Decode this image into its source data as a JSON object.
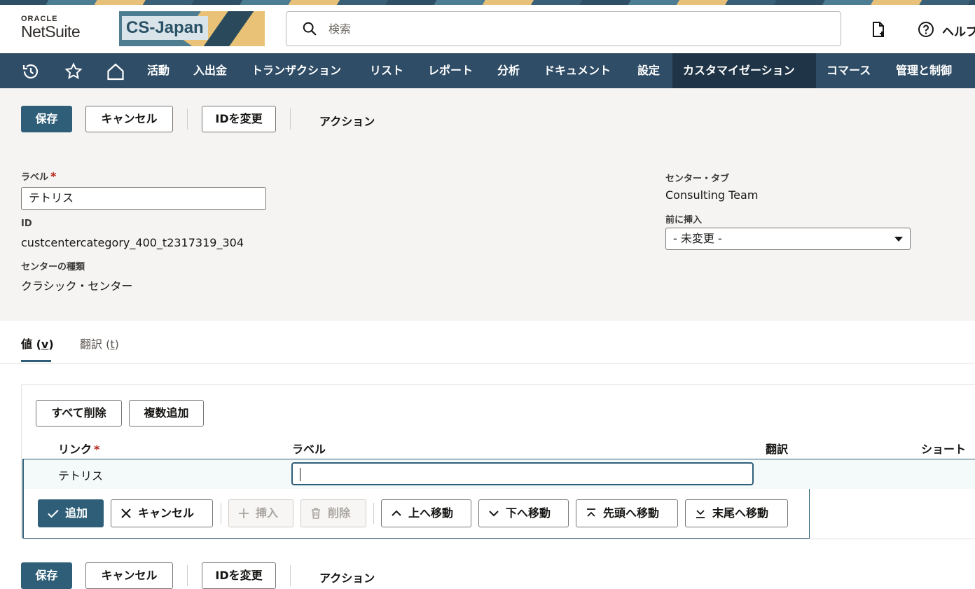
{
  "header": {
    "logo_top": "ORACLE",
    "logo_bottom": "NetSuite",
    "banner_text": "CS-Japan",
    "search_placeholder": "検索",
    "help_label": "ヘルプ"
  },
  "nav": {
    "items": [
      "活動",
      "入出金",
      "トランザクション",
      "リスト",
      "レポート",
      "分析",
      "ドキュメント",
      "設定",
      "カスタマイゼーション",
      "コマース",
      "管理と制御"
    ],
    "active_index": 8
  },
  "toolbar": {
    "save": "保存",
    "cancel": "キャンセル",
    "change_id": "IDを変更",
    "actions": "アクション"
  },
  "form": {
    "label_label": "ラベル",
    "required_mark": "*",
    "label_value": "テトリス",
    "id_label": "ID",
    "id_value": "custcentercategory_400_t2317319_304",
    "center_type_label": "センターの種類",
    "center_type_value": "クラシック・センター",
    "center_tab_label": "センター・タブ",
    "center_tab_value": "Consulting Team",
    "insert_before_label": "前に挿入",
    "insert_before_value": "- 未変更 -"
  },
  "tabs": [
    {
      "label": "値 (",
      "key": "v",
      "suffix": ")"
    },
    {
      "label": "翻訳 (",
      "key": "t",
      "suffix": ")"
    }
  ],
  "sublist": {
    "remove_all": "すべて削除",
    "add_multiple": "複数追加",
    "columns": {
      "link": "リンク",
      "label": "ラベル",
      "translation": "翻訳",
      "shortcut": "ショート"
    },
    "row": {
      "link": "テトリス",
      "label": ""
    },
    "buttons": {
      "add": "追加",
      "cancel": "キャンセル",
      "insert": "挿入",
      "delete": "削除",
      "move_up": "上へ移動",
      "move_down": "下へ移動",
      "move_top": "先頭へ移動",
      "move_bottom": "末尾へ移動"
    }
  },
  "colors": {
    "nav_bg": "#2f4d66",
    "nav_active": "#1f3547",
    "primary": "#2f5f78",
    "required": "#b52316"
  }
}
